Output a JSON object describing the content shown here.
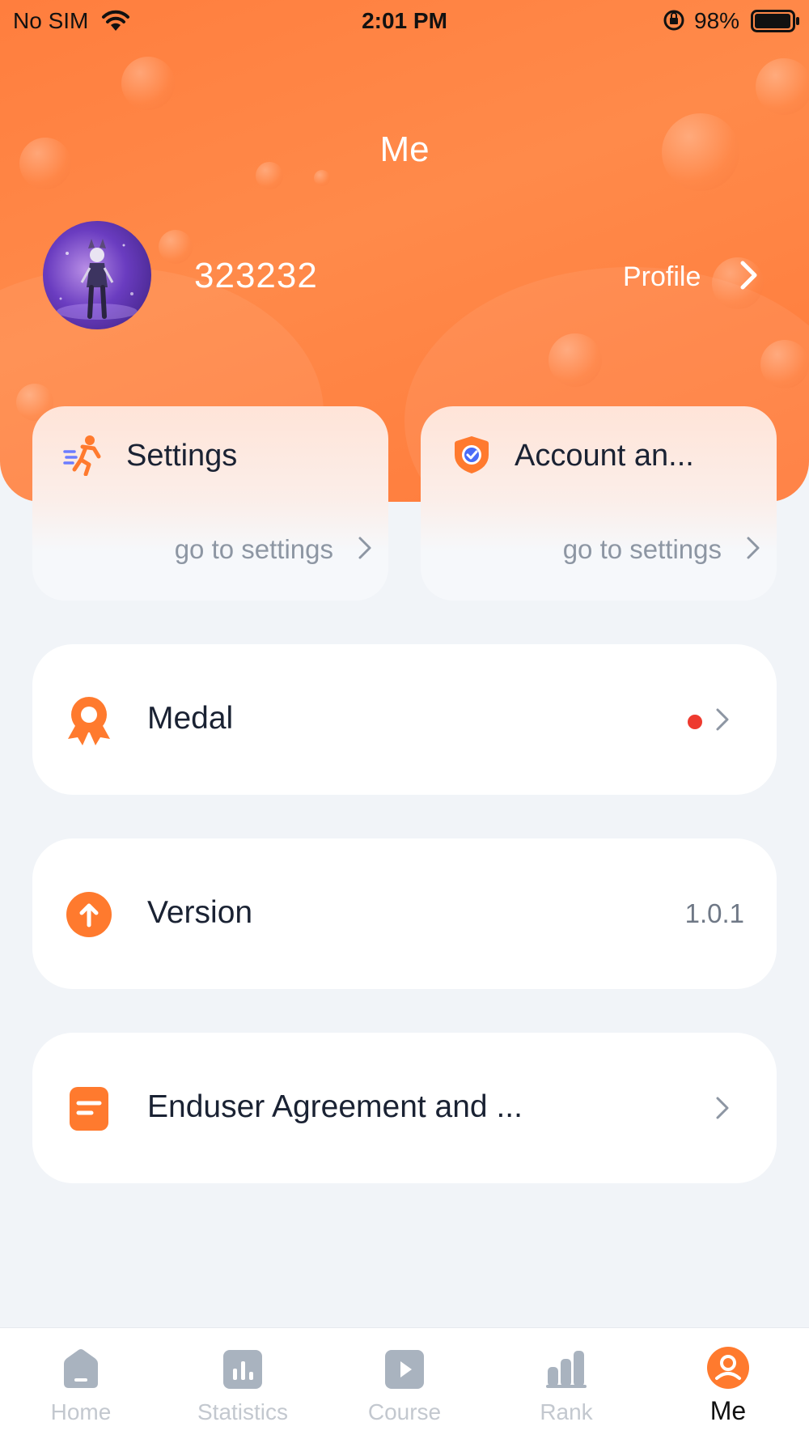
{
  "status_bar": {
    "carrier": "No SIM",
    "time": "2:01 PM",
    "battery": "98%"
  },
  "header": {
    "title": "Me",
    "username": "323232",
    "profile_label": "Profile",
    "avatar_icon": "user-avatar"
  },
  "quick_cards": [
    {
      "title": "Settings",
      "link": "go to settings",
      "icon": "runner-icon"
    },
    {
      "title": "Account an...",
      "link": "go to settings",
      "icon": "shield-check-icon"
    }
  ],
  "list": [
    {
      "label": "Medal",
      "icon": "medal-icon",
      "has_badge": true
    },
    {
      "label": "Version",
      "value": "1.0.1",
      "icon": "upgrade-icon"
    },
    {
      "label": "Enduser Agreement and ...",
      "icon": "document-icon"
    }
  ],
  "tabs": [
    {
      "label": "Home",
      "icon": "home-icon",
      "active": false
    },
    {
      "label": "Statistics",
      "icon": "statistics-icon",
      "active": false
    },
    {
      "label": "Course",
      "icon": "course-play-icon",
      "active": false
    },
    {
      "label": "Rank",
      "icon": "rank-icon",
      "active": false
    },
    {
      "label": "Me",
      "icon": "me-icon",
      "active": true
    }
  ],
  "colors": {
    "accent": "#ff7e3e",
    "background": "#f1f4f8",
    "badge": "#ee3a2f",
    "tab_inactive": "#c3c8cf"
  }
}
